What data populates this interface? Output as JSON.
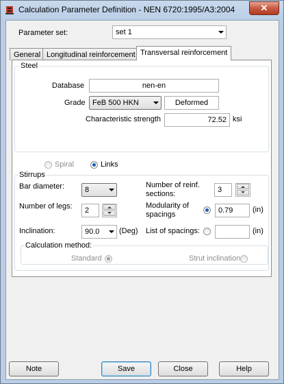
{
  "window": {
    "title": "Calculation Parameter Definition - NEN 6720:1995/A3:2004",
    "close_glyph": "✕"
  },
  "parameter_set": {
    "label": "Parameter set:",
    "value": "set 1"
  },
  "tabs": [
    {
      "label": "General"
    },
    {
      "label": "Longitudinal reinforcement"
    },
    {
      "label": "Transversal reinforcement"
    }
  ],
  "steel": {
    "title": "Steel",
    "database_label": "Database",
    "database_value": "nen-en",
    "grade_label": "Grade",
    "grade_value": "FeB 500 HKN",
    "grade_type": "Deformed",
    "char_strength_label": "Characteristic strength",
    "char_strength_value": "72.52",
    "char_strength_unit": "ksi"
  },
  "stirrup_type": {
    "spiral_label": "Spiral",
    "links_label": "Links"
  },
  "stirrups": {
    "title": "Stirrups",
    "bar_diameter_label": "Bar diameter:",
    "bar_diameter_value": "8",
    "num_reinf_label_1": "Number of reinf.",
    "num_reinf_label_2": "sections:",
    "num_reinf_value": "3",
    "num_legs_label": "Number of legs:",
    "num_legs_value": "2",
    "modularity_label_1": "Modularity of",
    "modularity_label_2": "spacings",
    "modularity_value": "0.79",
    "modularity_unit": "(in)",
    "inclination_label": "Inclination:",
    "inclination_value": "90.0",
    "inclination_unit": "(Deg)",
    "list_spacings_label": "List of spacings:",
    "list_spacings_value": "",
    "list_spacings_unit": "(in)"
  },
  "calc_method": {
    "title": "Calculation method:",
    "standard_label": "Standard",
    "strut_label": "Strut inclination"
  },
  "buttons": {
    "note": "Note",
    "save": "Save",
    "close": "Close",
    "help": "Help"
  }
}
